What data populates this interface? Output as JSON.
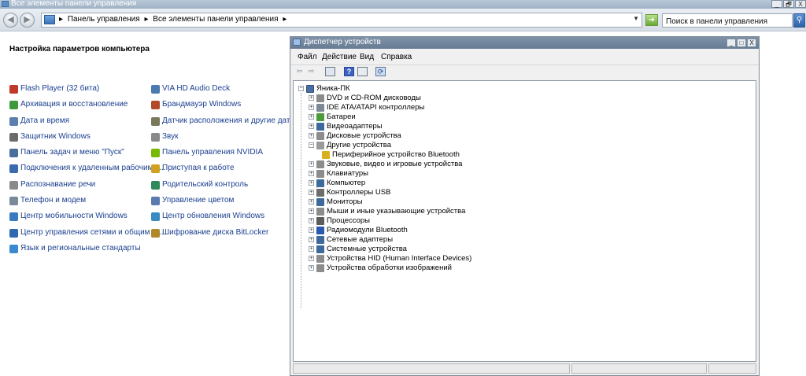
{
  "window": {
    "title": "Все элементы панели управления",
    "controls": [
      "_",
      "🗗",
      "X"
    ]
  },
  "address": {
    "crumbs": [
      "Панель управления",
      "Все элементы панели управления"
    ],
    "search_placeholder": "Поиск в панели управления"
  },
  "control_panel": {
    "heading": "Настройка параметров компьютера",
    "left_items": [
      {
        "label": "Flash Player (32 бита)",
        "icon": "flash-icon",
        "color": "#c0392b"
      },
      {
        "label": "Архивация и восстановление",
        "icon": "backup-icon",
        "color": "#3c9a3c"
      },
      {
        "label": "Дата и время",
        "icon": "clock-icon",
        "color": "#5b7fb0"
      },
      {
        "label": "Защитник Windows",
        "icon": "defender-icon",
        "color": "#6c6c6c"
      },
      {
        "label": "Панель задач и меню \"Пуск\"",
        "icon": "taskbar-icon",
        "color": "#4a6f9c"
      },
      {
        "label": "Подключения к удаленным рабочим с...",
        "icon": "remote-icon",
        "color": "#3a6ab0"
      },
      {
        "label": "Распознавание речи",
        "icon": "microphone-icon",
        "color": "#8a8a8a"
      },
      {
        "label": "Телефон и модем",
        "icon": "phone-icon",
        "color": "#7a8a9a"
      },
      {
        "label": "Центр мобильности Windows",
        "icon": "mobility-icon",
        "color": "#3a7ac0"
      },
      {
        "label": "Центр управления сетями и общим д...",
        "icon": "network-icon",
        "color": "#2f6ab0"
      },
      {
        "label": "Язык и региональные стандарты",
        "icon": "globe-icon",
        "color": "#3b8ad0"
      }
    ],
    "right_items": [
      {
        "label": "VIA HD Audio Deck",
        "icon": "audio-icon",
        "color": "#4a7ab0"
      },
      {
        "label": "Брандмауэр Windows",
        "icon": "firewall-icon",
        "color": "#b04a2a"
      },
      {
        "label": "Датчик расположения и другие датч...",
        "icon": "sensor-icon",
        "color": "#7a7a5a"
      },
      {
        "label": "Звук",
        "icon": "speaker-icon",
        "color": "#8a8a8a"
      },
      {
        "label": "Панель управления NVIDIA",
        "icon": "nvidia-icon",
        "color": "#76b900"
      },
      {
        "label": "Приступая к работе",
        "icon": "getting-started-icon",
        "color": "#d0a020"
      },
      {
        "label": "Родительский контроль",
        "icon": "parental-icon",
        "color": "#2f8a5a"
      },
      {
        "label": "Управление цветом",
        "icon": "color-icon",
        "color": "#5a7ab0"
      },
      {
        "label": "Центр обновления Windows",
        "icon": "update-icon",
        "color": "#3a8ac0"
      },
      {
        "label": "Шифрование диска BitLocker",
        "icon": "bitlocker-icon",
        "color": "#b08a2a"
      }
    ]
  },
  "device_manager": {
    "title": "Диспетчер устройств",
    "menu": [
      "Файл",
      "Действие",
      "Вид",
      "Справка"
    ],
    "root": "Яника-ПК",
    "nodes": [
      {
        "label": "DVD и CD-ROM дисководы",
        "icon": "dvd-icon",
        "color": "#8c8c8c"
      },
      {
        "label": "IDE ATA/ATAPI контроллеры",
        "icon": "ide-icon",
        "color": "#7d8896"
      },
      {
        "label": "Батареи",
        "icon": "battery-icon",
        "color": "#4c9a3c"
      },
      {
        "label": "Видеоадаптеры",
        "icon": "display-adapter-icon",
        "color": "#3d6a9c"
      },
      {
        "label": "Дисковые устройства",
        "icon": "disk-icon",
        "color": "#8c8c8c"
      },
      {
        "label": "Другие устройства",
        "icon": "other-devices-icon",
        "color": "#9a9a9a",
        "expanded": true
      },
      {
        "label": "Периферийное устройство Bluetooth",
        "icon": "warning-device-icon",
        "color": "#d8b020",
        "child": true
      },
      {
        "label": "Звуковые, видео и игровые устройства",
        "icon": "sound-icon",
        "color": "#8c8c8c"
      },
      {
        "label": "Клавиатуры",
        "icon": "keyboard-icon",
        "color": "#8c8c8c"
      },
      {
        "label": "Компьютер",
        "icon": "computer-icon",
        "color": "#3d6a9c"
      },
      {
        "label": "Контроллеры USB",
        "icon": "usb-icon",
        "color": "#6c6c6c"
      },
      {
        "label": "Мониторы",
        "icon": "monitor-icon",
        "color": "#3d6a9c"
      },
      {
        "label": "Мыши и иные указывающие устройства",
        "icon": "mouse-icon",
        "color": "#8c8c8c"
      },
      {
        "label": "Процессоры",
        "icon": "cpu-icon",
        "color": "#5c5c5c"
      },
      {
        "label": "Радиомодули Bluetooth",
        "icon": "bluetooth-icon",
        "color": "#2a5ab0"
      },
      {
        "label": "Сетевые адаптеры",
        "icon": "network-adapter-icon",
        "color": "#3d6a9c"
      },
      {
        "label": "Системные устройства",
        "icon": "system-devices-icon",
        "color": "#3d6a9c"
      },
      {
        "label": "Устройства HID (Human Interface Devices)",
        "icon": "hid-icon",
        "color": "#8c8c8c"
      },
      {
        "label": "Устройства обработки изображений",
        "icon": "imaging-icon",
        "color": "#8c8c8c"
      }
    ]
  }
}
